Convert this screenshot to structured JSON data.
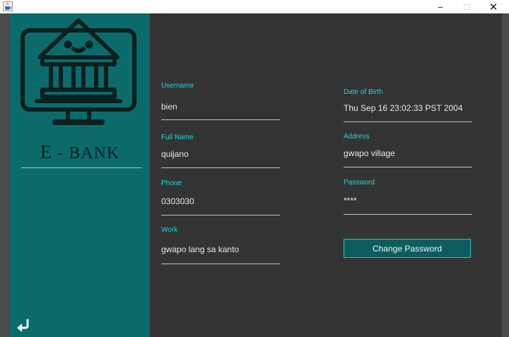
{
  "window": {
    "icon": "java-coffee-cup-icon",
    "minimize_label": "–",
    "maximize_label": "□",
    "close_label": "✕"
  },
  "sidebar": {
    "logo_icon": "bank-monitor-icon",
    "brand_first": "E",
    "brand_rest": " - BANK",
    "back_icon": "return-arrow-icon"
  },
  "profile": {
    "username": {
      "label": "Username",
      "value": "bien"
    },
    "full_name": {
      "label": "Full Name",
      "value": "quijano"
    },
    "phone": {
      "label": "Phone",
      "value": "0303030"
    },
    "work": {
      "label": "Work",
      "value": "gwapo lang sa kanto"
    },
    "date_of_birth": {
      "label": "Date of Birth",
      "value": "Thu Sep 16 23:02:33 PST 2004"
    },
    "address": {
      "label": "Address",
      "value": "gwapo village"
    },
    "password": {
      "label": "Password",
      "value": "****"
    }
  },
  "actions": {
    "change_password_label": "Change Password"
  },
  "colors": {
    "sidebar": "#0b6b6b",
    "content": "#333333",
    "label_accent": "#24d6d6",
    "logo_ink": "#0b1f1f"
  }
}
